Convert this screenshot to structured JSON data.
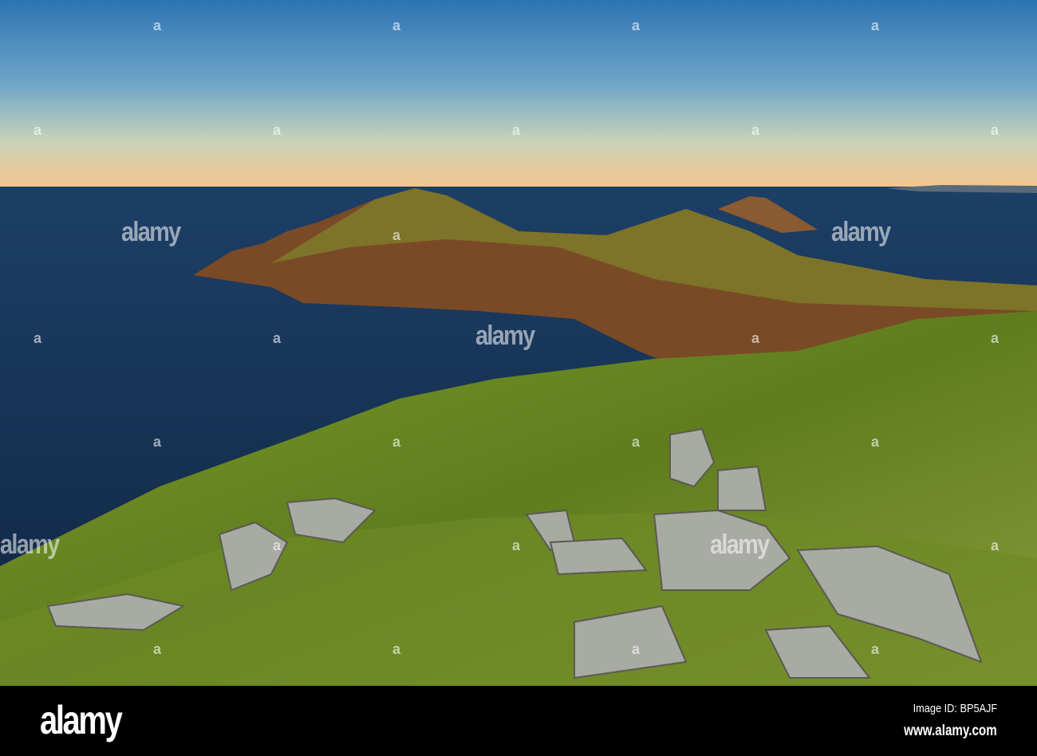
{
  "photo": {
    "subject": "Coastal headland at sunset"
  },
  "watermark": {
    "text": "alamy",
    "symbol": "a"
  },
  "footer": {
    "logo": "alamy",
    "image_id": "Image ID: BP5AJF",
    "url": "www.alamy.com"
  }
}
